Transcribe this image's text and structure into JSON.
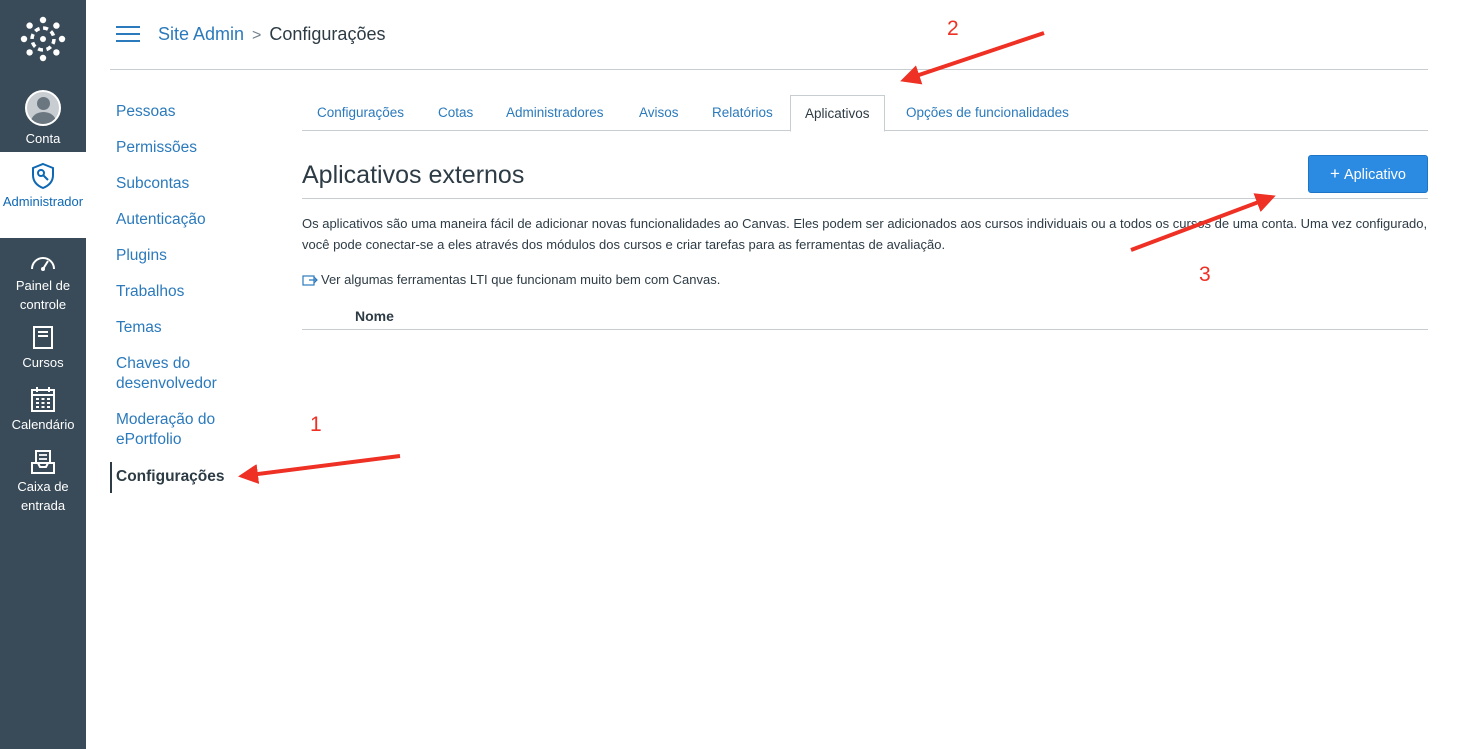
{
  "global_nav": {
    "items": [
      {
        "label": "Conta",
        "icon": "user-avatar-icon"
      },
      {
        "label": "Administrador",
        "icon": "admin-shield-icon",
        "active": true
      },
      {
        "label": "Painel de controle",
        "icon": "dashboard-gauge-icon"
      },
      {
        "label": "Cursos",
        "icon": "book-icon"
      },
      {
        "label": "Calendário",
        "icon": "calendar-icon"
      },
      {
        "label": "Caixa de entrada",
        "icon": "inbox-icon"
      }
    ],
    "colors": {
      "background": "#394b58",
      "active_text": "#0e68b3"
    }
  },
  "header": {
    "breadcrumb": {
      "root": "Site Admin",
      "separator": ">",
      "current": "Configurações"
    }
  },
  "section_nav": {
    "items": [
      "Pessoas",
      "Permissões",
      "Subcontas",
      "Autenticação",
      "Plugins",
      "Trabalhos",
      "Temas",
      "Chaves do desenvolvedor",
      "Moderação do ePortfolio",
      "Configurações"
    ],
    "active": "Configurações"
  },
  "tabs": {
    "items": [
      "Configurações",
      "Cotas",
      "Administradores",
      "Avisos",
      "Relatórios",
      "Aplicativos",
      "Opções de funcionalidades"
    ],
    "active": "Aplicativos"
  },
  "main": {
    "title": "Aplicativos externos",
    "add_button": "Aplicativo",
    "description": "Os aplicativos são uma maneira fácil de adicionar novas funcionalidades ao Canvas. Eles podem ser adicionados aos cursos individuais ou a todos os cursos de uma conta. Uma vez configurado, você pode conectar-se a eles através dos módulos dos cursos e criar tarefas para as ferramentas de avaliação.",
    "lti_link": "Ver algumas ferramentas LTI que funcionam muito bem com Canvas.",
    "table": {
      "columns": [
        "Nome"
      ]
    }
  },
  "annotations": {
    "labels": [
      "1",
      "2",
      "3"
    ],
    "color": "#ee3124"
  },
  "colors": {
    "link": "#2b7abc",
    "button": "#2b8be3",
    "text": "#2d3b45",
    "border": "#c7cdd1"
  }
}
